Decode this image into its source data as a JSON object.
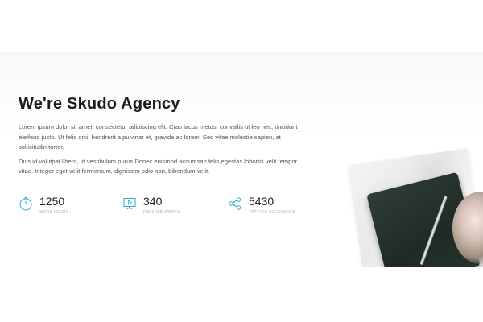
{
  "about": {
    "title": "We're Skudo Agency",
    "paragraph1": "Lorem ipsum dolor sit amet, consectetur adipiscing elit. Cras lacus metus, convallis ut leo nec, tincidunt eleifend justo. Ut felis orci, hendrerit a pulvinar et, gravida ac lorem. Sed vitae molestie sapien, at sollicitudin tortor.",
    "paragraph2": "Duis id volutpat libero, id vestibulum purus.Donec euismod accumsan felis,egestas lobortis velit tempor vitae. Integer eget velit fermentum, dignissim odio non, bibendum velit."
  },
  "stats": [
    {
      "icon": "stopwatch-icon",
      "value": "1250",
      "label": "WORK HOURS"
    },
    {
      "icon": "presentation-icon",
      "value": "340",
      "label": "FINISHED WORKS"
    },
    {
      "icon": "share-icon",
      "value": "5430",
      "label": "TWITTER FOLLOWERS"
    }
  ],
  "colors": {
    "accent": "#2aa8d6",
    "heading": "#1b1b1b",
    "body_text": "#555555",
    "muted": "#a9a9a9"
  }
}
